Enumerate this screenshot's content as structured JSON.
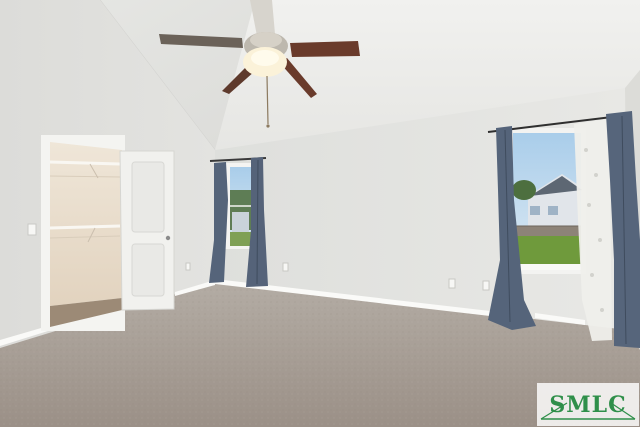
{
  "watermark": {
    "text": "SMLC",
    "colors": {
      "text": "#2f8f4a",
      "backing": "#ffffff"
    }
  },
  "colors": {
    "wall": "#e4e4e1",
    "ceiling": "#ecedea",
    "carpet": "#a79d92",
    "curtain": "#56657a",
    "sheer": "#eeeeea",
    "fan_blade": "#6a3b2b",
    "sky": "#b9d8f0",
    "lawn": "#6f9a3c"
  }
}
